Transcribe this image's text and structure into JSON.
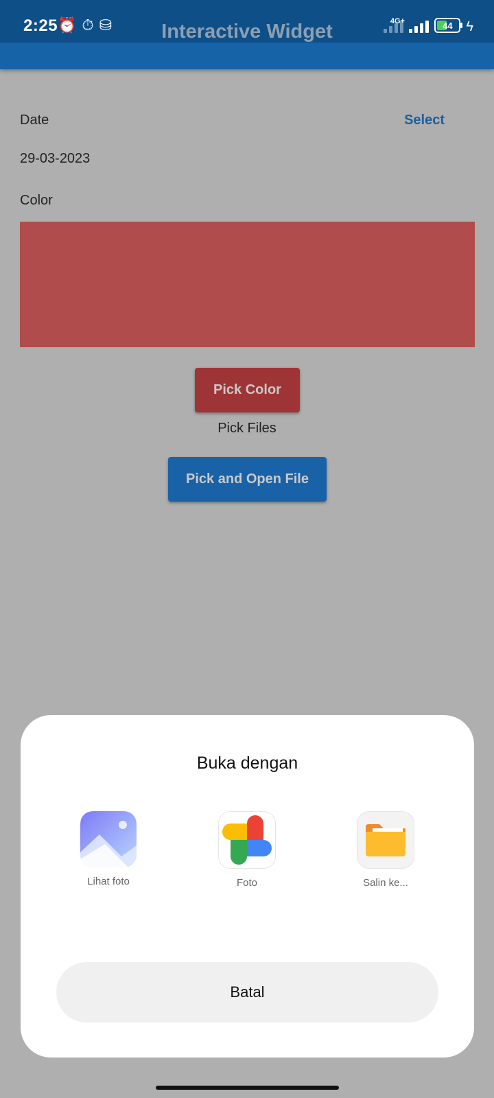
{
  "status_bar": {
    "time": "2:25",
    "network": "4G+",
    "battery": "44",
    "battery_level_percent": 44
  },
  "app_bar": {
    "title": "Interactive Widget"
  },
  "form": {
    "date_label": "Date",
    "select_label": "Select",
    "date_value": "29-03-2023",
    "color_label": "Color",
    "selected_color": "#b04c4c",
    "pick_color_label": "Pick Color",
    "pick_files_text": "Pick Files",
    "pick_open_file_label": "Pick and Open File"
  },
  "sheet": {
    "title": "Buka dengan",
    "apps": [
      {
        "label": "Lihat foto",
        "icon": "gallery-icon"
      },
      {
        "label": "Foto",
        "icon": "google-photos-icon"
      },
      {
        "label": "Salin ke...",
        "icon": "folder-icon"
      }
    ],
    "cancel_label": "Batal"
  },
  "colors": {
    "primary": "#1763a8",
    "accent_red": "#9f3437",
    "scrim": "#afafaf"
  }
}
